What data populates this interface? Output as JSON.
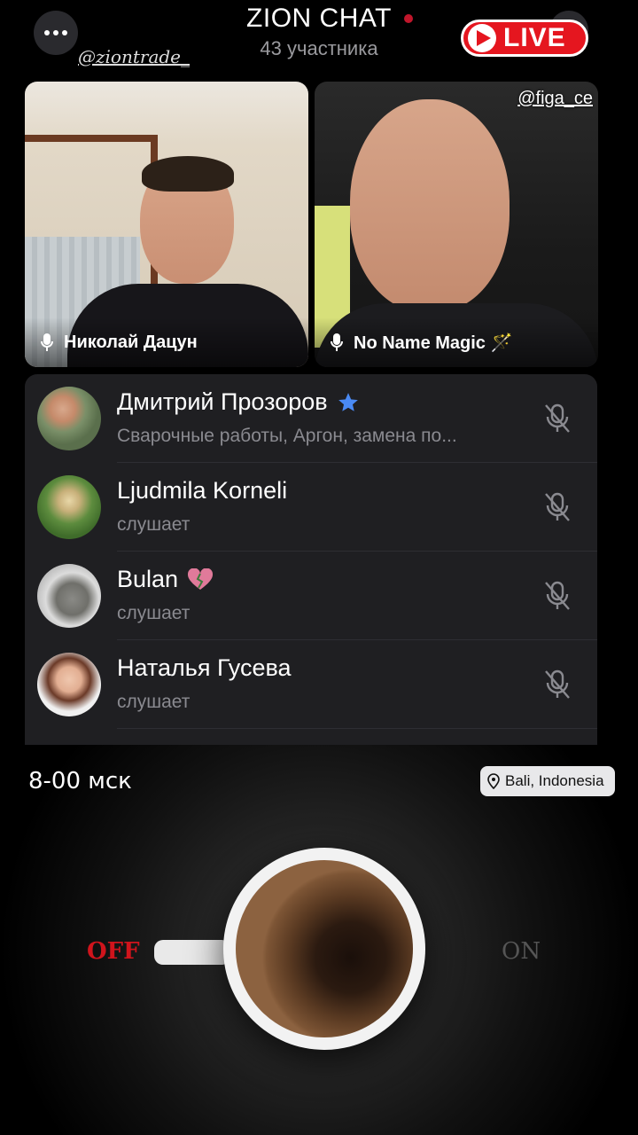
{
  "header": {
    "title": "ZION CHAT",
    "subtitle": "43 участника",
    "handle": "@ziontrade_",
    "live_label": "LIVE"
  },
  "video_tiles": [
    {
      "name": "Николай Дацун"
    },
    {
      "name": "No Name Magic 🪄",
      "handle": "@figa_ce"
    }
  ],
  "participants": [
    {
      "name": "Дмитрий Прозоров",
      "badge": "star-icon",
      "status": "Сварочные работы, Аргон, замена по..."
    },
    {
      "name": "Ljudmila Korneli",
      "status": "слушает"
    },
    {
      "name": "Bulan",
      "badge": "heart-emoji",
      "status": "слушает"
    },
    {
      "name": "Наталья Гусева",
      "status": "слушает"
    }
  ],
  "story": {
    "time": "8-00 мск",
    "location": "Bali, Indonesia",
    "off_label": "OFF",
    "on_label": "ON"
  },
  "colors": {
    "live": "#e5161f",
    "star": "#4a8af4",
    "off": "#d0141c"
  }
}
